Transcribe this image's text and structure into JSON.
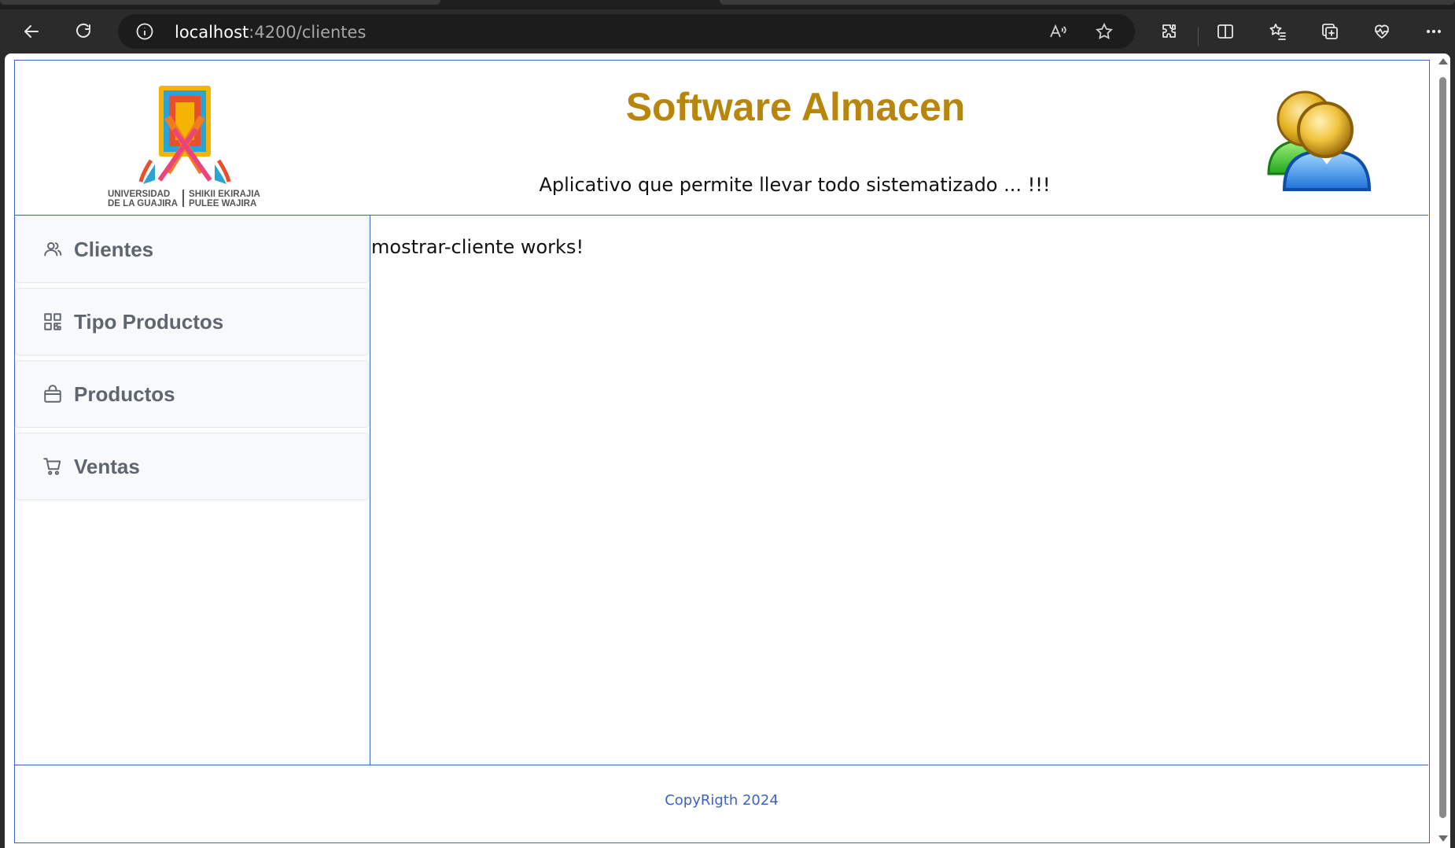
{
  "browser": {
    "url_host": "localhost",
    "url_path": ":4200/clientes"
  },
  "header": {
    "logo_line1_left": "UNIVERSIDAD",
    "logo_line2_left": "DE LA GUAJIRA",
    "logo_line1_right": "SHIKII EKIRAJIA",
    "logo_line2_right": "PULEE  WAJIRA",
    "title": "Software Almacen",
    "subtitle": "Aplicativo que permite llevar todo sistematizado ... !!!"
  },
  "sidebar": {
    "items": [
      {
        "label": "Clientes",
        "icon": "people-icon"
      },
      {
        "label": "Tipo Productos",
        "icon": "qr-grid-icon"
      },
      {
        "label": "Productos",
        "icon": "bag-icon"
      },
      {
        "label": "Ventas",
        "icon": "cart-icon"
      }
    ]
  },
  "content": {
    "message": "mostrar-cliente works!"
  },
  "footer": {
    "copyright": "CopyRigth 2024"
  },
  "colors": {
    "accent_border": "#3b63c4",
    "title": "#b8860b",
    "nav_text": "#5f6670",
    "footer_text": "#3b63c4"
  }
}
